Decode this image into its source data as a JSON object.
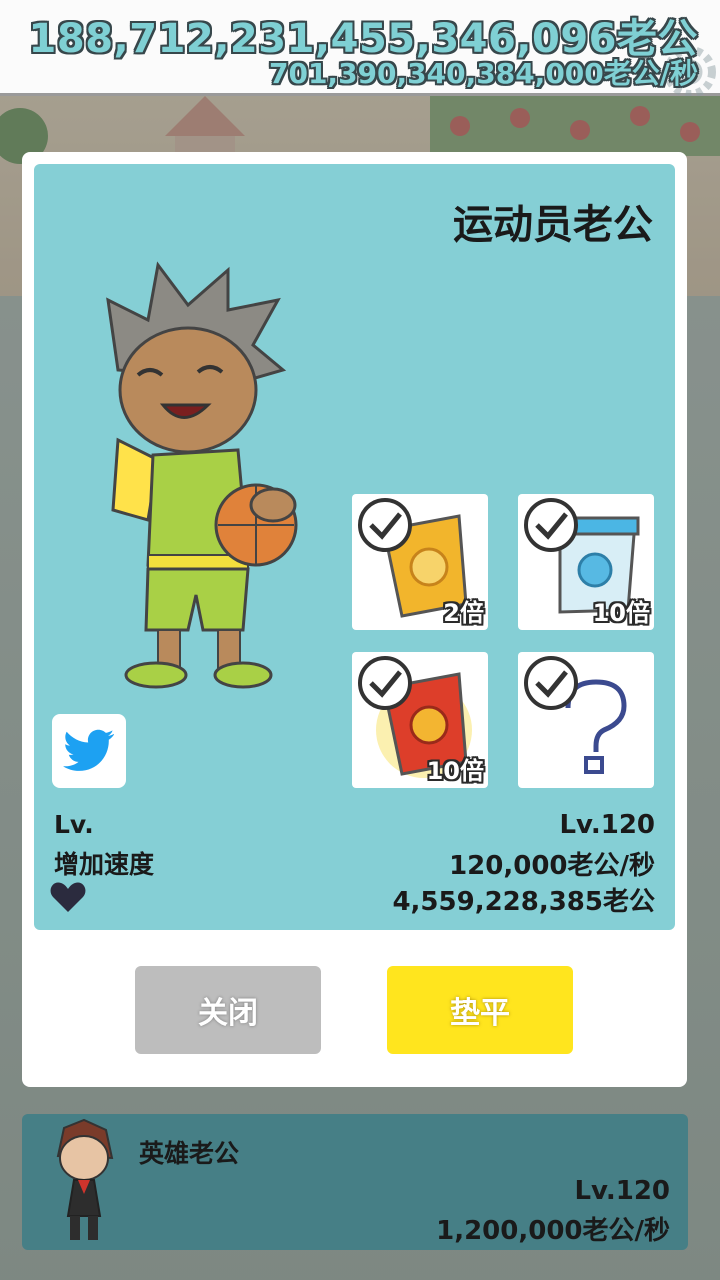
{
  "header": {
    "total_amount": "188,712,231,455,346,096老公",
    "rate": "701,390,340,384,000老公/秒",
    "settings_icon": "gear-icon"
  },
  "dialog": {
    "character_name": "运动员老公",
    "share_icon": "twitter-icon",
    "items": [
      {
        "multiplier": "2倍",
        "icon": "gold-cup-icon",
        "checked": true
      },
      {
        "multiplier": "10倍",
        "icon": "blue-cup-icon",
        "checked": true
      },
      {
        "multiplier": "10倍",
        "icon": "red-cup-icon",
        "checked": true
      },
      {
        "multiplier": "",
        "icon": "question-mark-icon",
        "checked": true
      }
    ],
    "stats": {
      "level_label": "Lv.",
      "level_value": "Lv.120",
      "speed_label": "增加速度",
      "speed_value": "120,000老公/秒",
      "favorite_icon": "heart-icon",
      "favorite_value": "4,559,228,385老公"
    },
    "buttons": {
      "close_label": "关闭",
      "level_up_label": "垫平"
    },
    "colors": {
      "card_bg": "#85cfd5",
      "close_button": "#bdbdbd",
      "level_button": "#ffe51e"
    }
  },
  "list": {
    "item_name": "英雄老公",
    "item_level": "Lv.120",
    "item_rate": "1,200,000老公/秒"
  }
}
